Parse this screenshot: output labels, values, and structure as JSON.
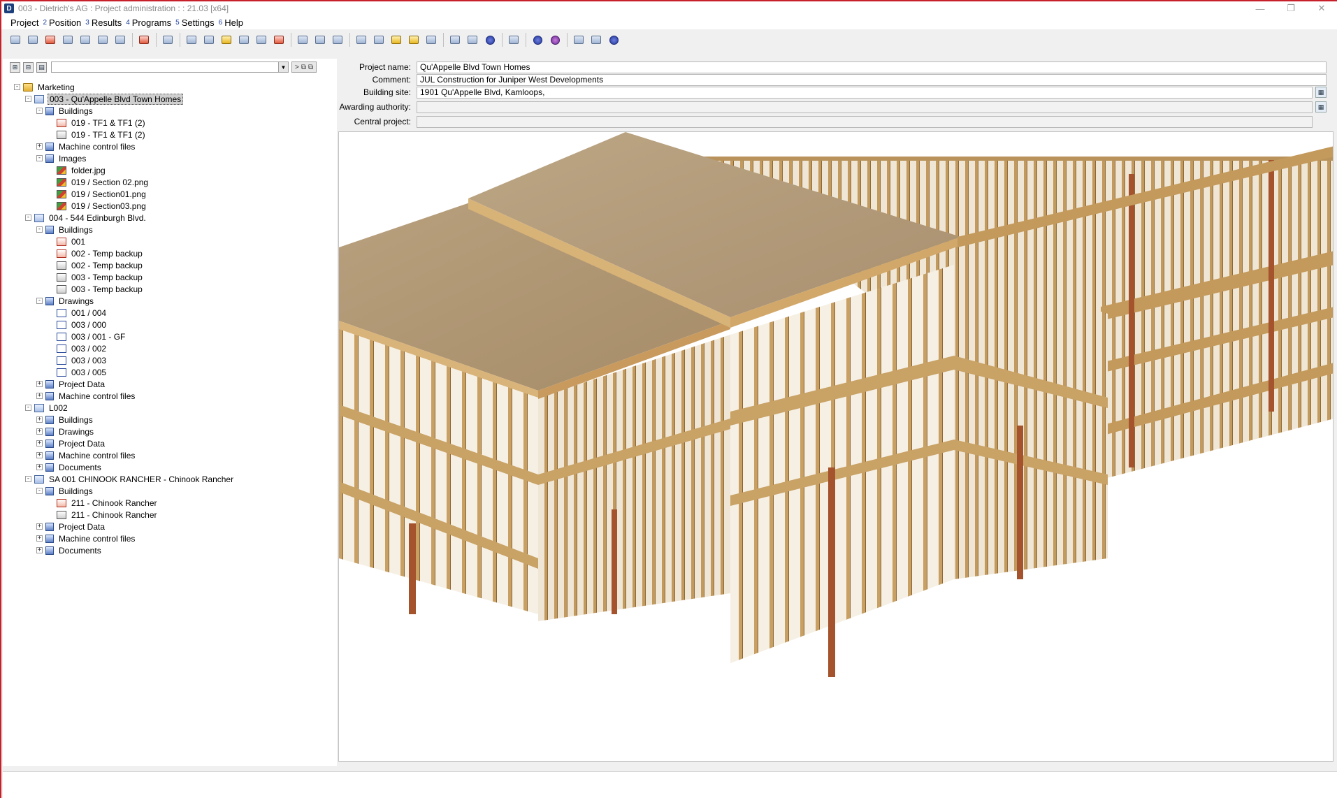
{
  "window": {
    "title": "003 - Dietrich's AG : Project administration : : 21.03 [x64]",
    "app_icon": "D",
    "controls": [
      "minimize-icon",
      "restore-icon",
      "close-icon"
    ],
    "control_glyphs": {
      "minimize": "—",
      "restore": "❐",
      "close": "✕"
    }
  },
  "menu": [
    {
      "num": "",
      "label": "Project"
    },
    {
      "num": "2",
      "label": "Position"
    },
    {
      "num": "3",
      "label": "Results"
    },
    {
      "num": "4",
      "label": "Programs"
    },
    {
      "num": "5",
      "label": "Settings"
    },
    {
      "num": "6",
      "label": "Help"
    }
  ],
  "fields": {
    "project_name": {
      "label": "Project name:",
      "value": "Qu'Appelle Blvd Town Homes"
    },
    "comment": {
      "label": "Comment:",
      "value": "JUL Construction for Juniper West Developments"
    },
    "building_site": {
      "label": "Building site:",
      "value": "1901 Qu'Appelle Blvd, Kamloops,"
    },
    "awarding_authority": {
      "label": "Awarding authority:",
      "value": ""
    },
    "central_project": {
      "label": "Central project:",
      "value": ""
    }
  },
  "tree_toolbar": {
    "go_label": ">"
  },
  "tree": [
    {
      "depth": 0,
      "toggle": "-",
      "icon": "folder",
      "label": "Marketing"
    },
    {
      "depth": 1,
      "toggle": "-",
      "icon": "project",
      "label": "003 - Qu'Appelle Blvd Town Homes",
      "selected": true
    },
    {
      "depth": 2,
      "toggle": "-",
      "icon": "group",
      "label": "Buildings"
    },
    {
      "depth": 3,
      "toggle": "",
      "icon": "building-red",
      "label": "019 - TF1 & TF1 (2)"
    },
    {
      "depth": 3,
      "toggle": "",
      "icon": "building",
      "label": "019 - TF1 & TF1 (2)"
    },
    {
      "depth": 2,
      "toggle": "+",
      "icon": "group",
      "label": "Machine control files"
    },
    {
      "depth": 2,
      "toggle": "-",
      "icon": "group",
      "label": "Images"
    },
    {
      "depth": 3,
      "toggle": "",
      "icon": "image",
      "label": "folder.jpg"
    },
    {
      "depth": 3,
      "toggle": "",
      "icon": "image",
      "label": "019 / Section 02.png"
    },
    {
      "depth": 3,
      "toggle": "",
      "icon": "image",
      "label": "019 / Section01.png"
    },
    {
      "depth": 3,
      "toggle": "",
      "icon": "image",
      "label": "019 / Section03.png"
    },
    {
      "depth": 1,
      "toggle": "-",
      "icon": "project",
      "label": "004 - 544 Edinburgh Blvd."
    },
    {
      "depth": 2,
      "toggle": "-",
      "icon": "group",
      "label": "Buildings"
    },
    {
      "depth": 3,
      "toggle": "",
      "icon": "building-red",
      "label": "001"
    },
    {
      "depth": 3,
      "toggle": "",
      "icon": "building-red",
      "label": "002 - Temp backup"
    },
    {
      "depth": 3,
      "toggle": "",
      "icon": "building",
      "label": "002 - Temp backup"
    },
    {
      "depth": 3,
      "toggle": "",
      "icon": "building",
      "label": "003 - Temp backup"
    },
    {
      "depth": 3,
      "toggle": "",
      "icon": "building",
      "label": "003 - Temp backup"
    },
    {
      "depth": 2,
      "toggle": "-",
      "icon": "group",
      "label": "Drawings"
    },
    {
      "depth": 3,
      "toggle": "",
      "icon": "drawing",
      "label": "001 / 004"
    },
    {
      "depth": 3,
      "toggle": "",
      "icon": "drawing",
      "label": "003 / 000"
    },
    {
      "depth": 3,
      "toggle": "",
      "icon": "drawing",
      "label": "003 / 001 - GF"
    },
    {
      "depth": 3,
      "toggle": "",
      "icon": "drawing",
      "label": "003 / 002"
    },
    {
      "depth": 3,
      "toggle": "",
      "icon": "drawing",
      "label": "003 / 003"
    },
    {
      "depth": 3,
      "toggle": "",
      "icon": "drawing",
      "label": "003 / 005"
    },
    {
      "depth": 2,
      "toggle": "+",
      "icon": "group",
      "label": "Project Data"
    },
    {
      "depth": 2,
      "toggle": "+",
      "icon": "group",
      "label": "Machine control files"
    },
    {
      "depth": 1,
      "toggle": "-",
      "icon": "project",
      "label": "L002"
    },
    {
      "depth": 2,
      "toggle": "+",
      "icon": "group",
      "label": "Buildings"
    },
    {
      "depth": 2,
      "toggle": "+",
      "icon": "group",
      "label": "Drawings"
    },
    {
      "depth": 2,
      "toggle": "+",
      "icon": "group",
      "label": "Project Data"
    },
    {
      "depth": 2,
      "toggle": "+",
      "icon": "group",
      "label": "Machine control files"
    },
    {
      "depth": 2,
      "toggle": "+",
      "icon": "group",
      "label": "Documents"
    },
    {
      "depth": 1,
      "toggle": "-",
      "icon": "project",
      "label": "SA 001 CHINOOK RANCHER - Chinook Rancher"
    },
    {
      "depth": 2,
      "toggle": "-",
      "icon": "group",
      "label": "Buildings"
    },
    {
      "depth": 3,
      "toggle": "",
      "icon": "building-red",
      "label": "211 - Chinook Rancher"
    },
    {
      "depth": 3,
      "toggle": "",
      "icon": "building",
      "label": "211 - Chinook Rancher"
    },
    {
      "depth": 2,
      "toggle": "+",
      "icon": "group",
      "label": "Project Data"
    },
    {
      "depth": 2,
      "toggle": "+",
      "icon": "group",
      "label": "Machine control files"
    },
    {
      "depth": 2,
      "toggle": "+",
      "icon": "group",
      "label": "Documents"
    }
  ],
  "toolbar_groups": [
    [
      "new-project-icon",
      "open-project-icon",
      "delete-project-icon",
      "copy-project-icon",
      "export-project-icon",
      "import-project-icon",
      "properties-icon"
    ],
    [
      "exit-icon"
    ],
    [
      "copy-building-icon"
    ],
    [
      "new-file-icon",
      "open-file-icon",
      "image-file-icon",
      "export-file-icon",
      "import-file-icon",
      "print-file-icon"
    ],
    [
      "window-icon",
      "paste-icon",
      "scan-icon"
    ],
    [
      "database-icon",
      "ruler-icon",
      "folder-open-icon",
      "layout-icon",
      "settings-icon"
    ],
    [
      "pen-icon",
      "list-icon",
      "globe-icon"
    ],
    [
      "download-icon"
    ],
    [
      "help-icon",
      "info-icon"
    ],
    [
      "user-icon",
      "link-icon",
      "web-icon"
    ]
  ],
  "colors": {
    "accent_red": "#c8202a",
    "selection": "#cfcfcf",
    "lumber": "#c9a06a",
    "sheathing": "#b49a72"
  }
}
